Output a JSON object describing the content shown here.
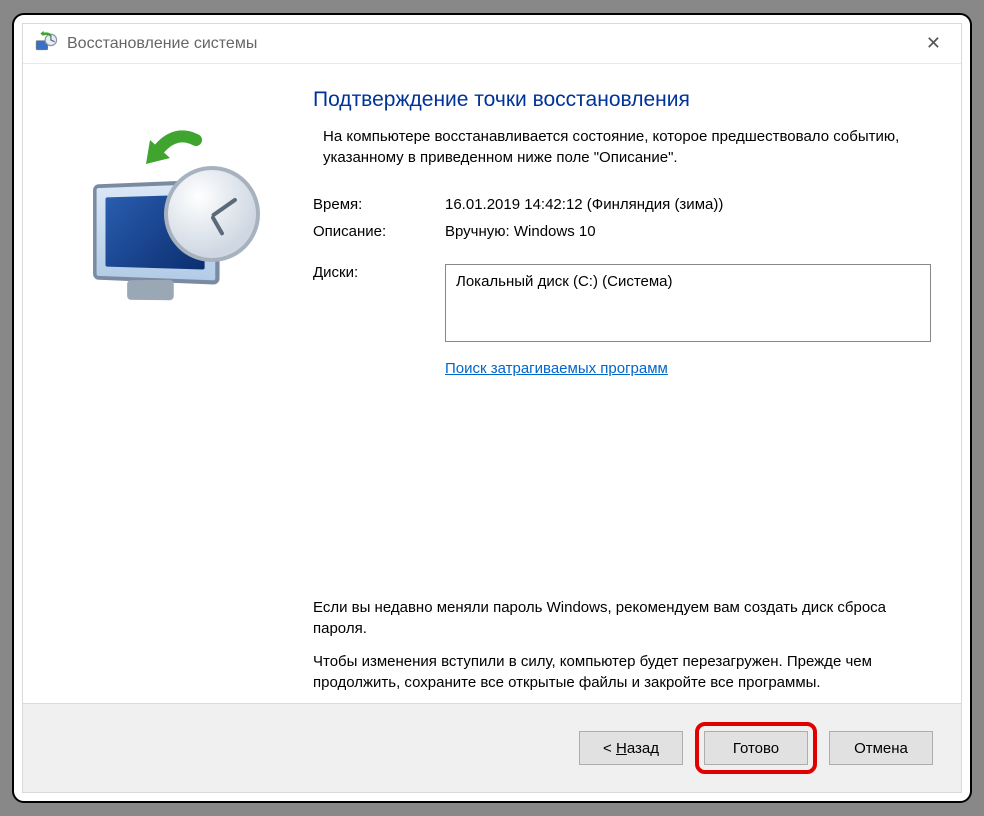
{
  "window": {
    "title": "Восстановление системы"
  },
  "main": {
    "heading": "Подтверждение точки восстановления",
    "intro": "На компьютере восстанавливается состояние, которое предшествовало событию, указанному в приведенном ниже поле \"Описание\".",
    "time_label": "Время:",
    "time_value": "16.01.2019 14:42:12 (Финляндия (зима))",
    "desc_label": "Описание:",
    "desc_value": "Вручную: Windows 10",
    "disks_label": "Диски:",
    "disks_value": "Локальный диск (C:) (Система)",
    "scan_link": "Поиск затрагиваемых программ",
    "note_password": "Если вы недавно меняли пароль Windows, рекомендуем вам создать диск сброса пароля.",
    "note_restart": "Чтобы изменения вступили в силу, компьютер будет перезагружен. Прежде чем продолжить, сохраните все открытые файлы и закройте все программы."
  },
  "footer": {
    "back_prefix": "< ",
    "back_letter": "Н",
    "back_rest": "азад",
    "finish": "Готово",
    "cancel": "Отмена"
  }
}
